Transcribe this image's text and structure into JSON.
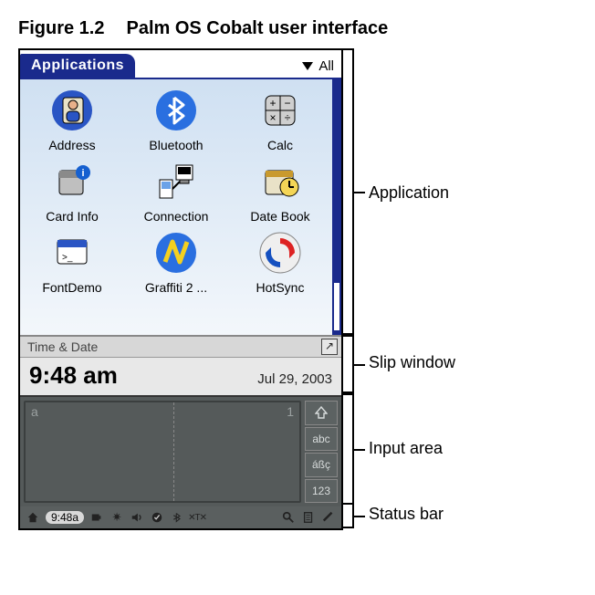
{
  "figure": {
    "number": "Figure 1.2",
    "caption": "Palm OS Cobalt user interface"
  },
  "topbar": {
    "tab_label": "Applications",
    "category": "All"
  },
  "apps": [
    {
      "name": "Address",
      "icon": "address-icon"
    },
    {
      "name": "Bluetooth",
      "icon": "bluetooth-icon"
    },
    {
      "name": "Calc",
      "icon": "calc-icon"
    },
    {
      "name": "Card Info",
      "icon": "cardinfo-icon"
    },
    {
      "name": "Connection",
      "icon": "connection-icon"
    },
    {
      "name": "Date Book",
      "icon": "datebook-icon"
    },
    {
      "name": "FontDemo",
      "icon": "fontdemo-icon"
    },
    {
      "name": "Graffiti 2 ...",
      "icon": "graffiti2-icon"
    },
    {
      "name": "HotSync",
      "icon": "hotsync-icon"
    }
  ],
  "slip": {
    "title": "Time & Date",
    "time": "9:48 am",
    "date": "Jul 29, 2003"
  },
  "input": {
    "left_hint": "a",
    "right_hint": "1",
    "modes": {
      "shift": "A",
      "abc": "abc",
      "intl": "áßç",
      "num": "123"
    }
  },
  "status": {
    "time": "9:48a",
    "icons": [
      "home-icon",
      "battery-icon",
      "brightness-icon",
      "sound-icon",
      "check-icon",
      "bluetooth-small-icon",
      "xtx-icon",
      "magnify-icon",
      "clipboard-icon",
      "pen-icon"
    ]
  },
  "callouts": {
    "application": "Application",
    "slip": "Slip window",
    "input": "Input area",
    "status": "Status bar"
  }
}
